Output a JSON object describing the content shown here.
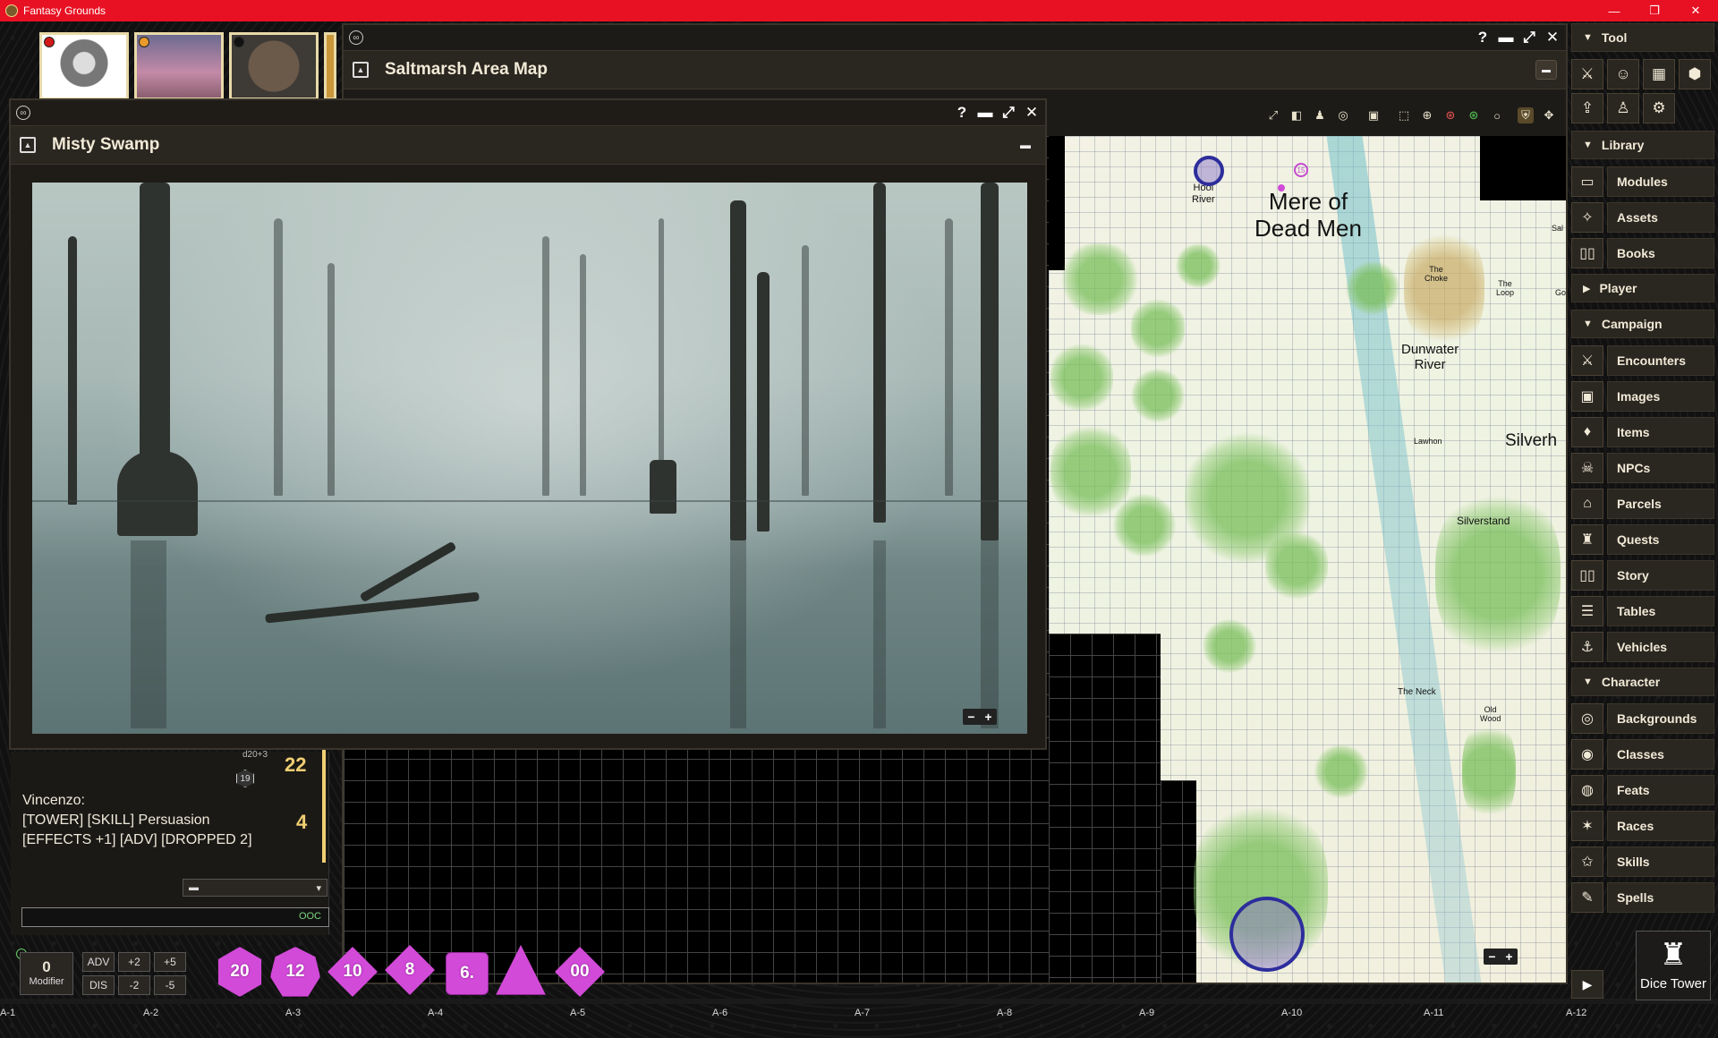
{
  "os": {
    "title": "Fantasy Grounds",
    "minimize": "—",
    "restore": "❐",
    "close": "✕"
  },
  "colors": {
    "titlebar": "#e81123",
    "dice": "#d24ad8",
    "accent_gold": "#f0cf73",
    "panel": "#2a2620"
  },
  "map_window": {
    "title": "Saltmarsh Area Map",
    "controls": [
      "?",
      "▬",
      "⤢",
      "✕"
    ],
    "toolbar_icons": [
      "expand-icon",
      "camera-icon",
      "person-icon",
      "target-icon",
      "mask-icon",
      "select-icon",
      "crosshair-icon",
      "target-red-icon",
      "target-green-icon",
      "circle-icon",
      "shield-icon",
      "move-icon"
    ],
    "labels": {
      "hool_river": "Hool\nRiver",
      "mere": "Mere of\nDead Men",
      "the_choke": "The\nChoke",
      "the_loop": "The\nLoop",
      "dunwater": "Dunwater\nRiver",
      "lawhon": "Lawhon",
      "silverh": "Silverh",
      "silverstand": "Silverstand",
      "the_neck": "The Neck",
      "old_wood": "Old\nWood",
      "sal": "Sal",
      "go": "Go"
    },
    "token_label": "15"
  },
  "swamp_window": {
    "title": "Misty Swamp",
    "controls": [
      "?",
      "▬",
      "⤢",
      "✕"
    ]
  },
  "chat": {
    "roll_expr": "d20+3",
    "roll_die": "19",
    "roll_total": "22",
    "speaker": "Vincenzo:",
    "line1": "[TOWER] [SKILL] Persuasion",
    "line2": "[EFFECTS +1] [ADV] [DROPPED 2]",
    "result": "4",
    "mode_icon": "speech-icon",
    "input_mode": "OOC"
  },
  "modifier": {
    "value": "0",
    "label": "Modifier",
    "buttons": [
      "ADV",
      "+2",
      "+5",
      "DIS",
      "-2",
      "-5"
    ]
  },
  "dice": [
    "20",
    "12",
    "10",
    "8",
    "6.",
    "",
    "00"
  ],
  "ruler": [
    "A-1",
    "A-2",
    "A-3",
    "A-4",
    "A-5",
    "A-6",
    "A-7",
    "A-8",
    "A-9",
    "A-10",
    "A-11",
    "A-12"
  ],
  "sidebar": {
    "tool_label": "Tool",
    "tool_icons_row1": [
      "swords-icon",
      "party-icon",
      "calendar-icon",
      "d20-icon"
    ],
    "tool_icons_row2": [
      "upload-icon",
      "user-icon",
      "gear-icon"
    ],
    "library_label": "Library",
    "library": [
      {
        "label": "Modules",
        "icon": "folder-icon",
        "glyph": "▭"
      },
      {
        "label": "Assets",
        "icon": "puzzle-icon",
        "glyph": "✧"
      },
      {
        "label": "Books",
        "icon": "book-icon",
        "glyph": "▯▯"
      }
    ],
    "player_label": "Player",
    "campaign_label": "Campaign",
    "campaign": [
      {
        "label": "Encounters",
        "icon": "sword-icon",
        "glyph": "⚔"
      },
      {
        "label": "Images",
        "icon": "image-icon",
        "glyph": "▣"
      },
      {
        "label": "Items",
        "icon": "bag-icon",
        "glyph": "♦"
      },
      {
        "label": "NPCs",
        "icon": "skull-icon",
        "glyph": "☠"
      },
      {
        "label": "Parcels",
        "icon": "chest-icon",
        "glyph": "⌂"
      },
      {
        "label": "Quests",
        "icon": "goblet-icon",
        "glyph": "♜"
      },
      {
        "label": "Story",
        "icon": "open-book-icon",
        "glyph": "▯▯"
      },
      {
        "label": "Tables",
        "icon": "list-icon",
        "glyph": "☰"
      },
      {
        "label": "Vehicles",
        "icon": "ship-icon",
        "glyph": "⚓"
      }
    ],
    "character_label": "Character",
    "character": [
      {
        "label": "Backgrounds",
        "icon": "fingerprint-icon",
        "glyph": "◎"
      },
      {
        "label": "Classes",
        "icon": "helmet-icon",
        "glyph": "◉"
      },
      {
        "label": "Feats",
        "icon": "feat-icon",
        "glyph": "◍"
      },
      {
        "label": "Races",
        "icon": "dna-icon",
        "glyph": "✶"
      },
      {
        "label": "Skills",
        "icon": "star-icon",
        "glyph": "✩"
      },
      {
        "label": "Spells",
        "icon": "wand-icon",
        "glyph": "✎"
      }
    ],
    "dice_tower": "Dice Tower"
  }
}
